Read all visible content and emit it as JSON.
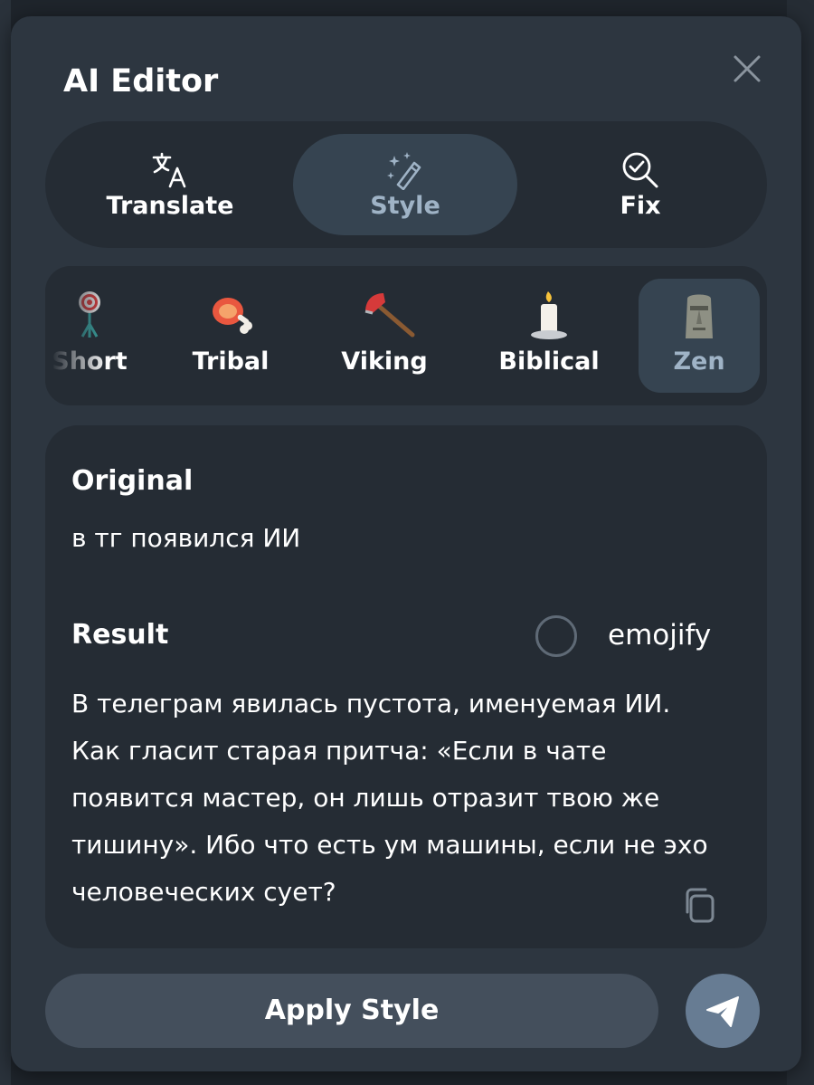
{
  "dialog": {
    "title": "AI Editor",
    "close_icon": "close-icon"
  },
  "modes": [
    {
      "label": "Translate",
      "icon": "translate-icon",
      "active": false
    },
    {
      "label": "Style",
      "icon": "magic-wand-icon",
      "active": true
    },
    {
      "label": "Fix",
      "icon": "magnifier-check-icon",
      "active": false
    }
  ],
  "styles": [
    {
      "label": "Short",
      "icon": "target-icon",
      "active": false
    },
    {
      "label": "Tribal",
      "icon": "meat-icon",
      "active": false
    },
    {
      "label": "Viking",
      "icon": "axe-icon",
      "active": false
    },
    {
      "label": "Biblical",
      "icon": "candle-icon",
      "active": false
    },
    {
      "label": "Zen",
      "icon": "moai-icon",
      "active": true
    }
  ],
  "original": {
    "heading": "Original",
    "text": "в тг появился ИИ"
  },
  "result": {
    "heading": "Result",
    "emojify_label": "emojify",
    "emojify_checked": false,
    "text": "В телеграм явилась пустота, именуемая ИИ. Как гласит старая притча: «Если в чате появится мастер, он лишь отразит твою же тишину». Ибо что есть ум машины, если не эхо человеческих сует?",
    "copy_icon": "copy-icon"
  },
  "footer": {
    "apply_label": "Apply Style",
    "send_icon": "send-icon"
  },
  "colors": {
    "dialog_bg": "#2d3640",
    "panel_bg": "#252c34",
    "active_bg": "#364451",
    "active_text": "#9fb3c6",
    "apply_bg": "#444f5c",
    "send_bg": "#677c93"
  }
}
